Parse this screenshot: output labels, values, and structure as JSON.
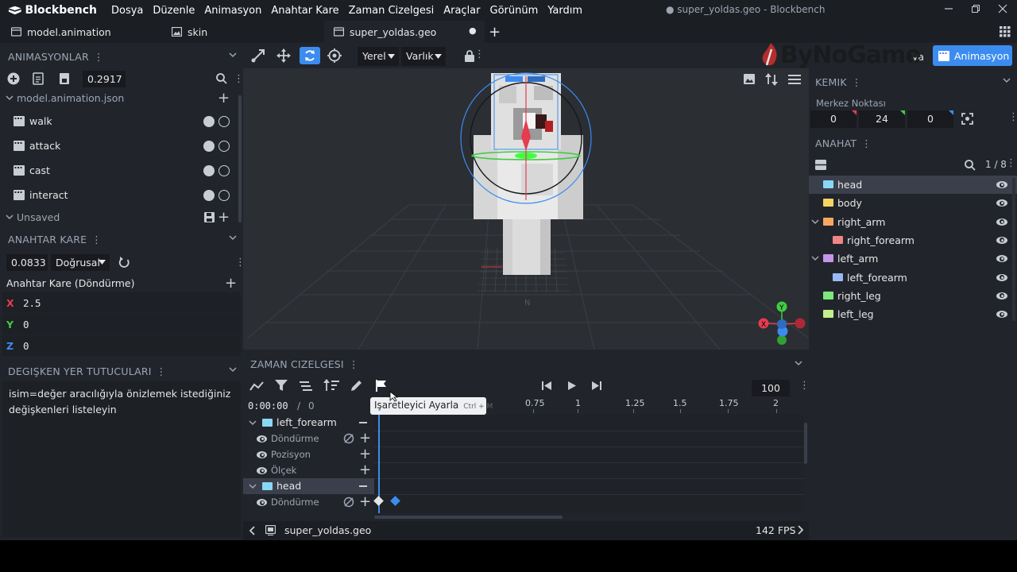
{
  "app": {
    "name": "Blockbench",
    "window_title": "● super_yoldas.geo - Blockbench"
  },
  "menus": [
    "Dosya",
    "Düzenle",
    "Animasyon",
    "Anahtar Kare",
    "Zaman Cizelgesi",
    "Araçlar",
    "Görünüm",
    "Yardım"
  ],
  "tabs": [
    {
      "label": "model.animation",
      "icon": "script-icon"
    },
    {
      "label": "skin",
      "icon": "image-icon"
    },
    {
      "label": "super_yoldas.geo",
      "icon": "model-icon",
      "active": true,
      "modified_marker": "●"
    }
  ],
  "animations_panel": {
    "title": "ANIMASYONLAR",
    "time_value": "0.2917",
    "file": "model.animation.json",
    "items": [
      "walk",
      "attack",
      "cast",
      "interact"
    ],
    "unsaved_label": "Unsaved"
  },
  "keyframe_panel": {
    "title": "ANAHTAR KARE",
    "time_value": "0.0833",
    "interpolation": "Doğrusal",
    "channel_title": "Anahtar Kare (Döndürme)",
    "axes": [
      {
        "axis": "X",
        "value": "2.5",
        "color": "#e53c50"
      },
      {
        "axis": "Y",
        "value": "0",
        "color": "#40cc40"
      },
      {
        "axis": "Z",
        "value": "0",
        "color": "#3c8cf0"
      }
    ]
  },
  "placeholders_panel": {
    "title": "DEGIŞKEN YER TUTUCULARI",
    "hint": "isim=değer aracılığıyla önizlemek istediğiniz değişkenleri listeleyin"
  },
  "viewport_toolbar": {
    "space_dropdown": "Yerel",
    "pivot_dropdown": "Varlık",
    "mode_label": "Animasyon",
    "other_mode_partial": "ya"
  },
  "watermark": "ByNoGame",
  "bone_panel": {
    "title": "KEMIK",
    "pivot_label": "Merkez Noktası",
    "pivot": [
      "0",
      "24",
      "0"
    ]
  },
  "outliner": {
    "title": "ANAHAT",
    "count": "1 / 8",
    "items": [
      {
        "name": "head",
        "color": "#8ad7f5",
        "level": 0,
        "selected": true
      },
      {
        "name": "body",
        "color": "#f3d564",
        "level": 0
      },
      {
        "name": "right_arm",
        "color": "#f5a960",
        "level": 0,
        "expanded": true
      },
      {
        "name": "right_forearm",
        "color": "#f08585",
        "level": 1
      },
      {
        "name": "left_arm",
        "color": "#c694e8",
        "level": 0,
        "expanded": true
      },
      {
        "name": "left_forearm",
        "color": "#9bb8f5",
        "level": 1
      },
      {
        "name": "right_leg",
        "color": "#7de87d",
        "level": 0
      },
      {
        "name": "left_leg",
        "color": "#c2f08a",
        "level": 0
      }
    ]
  },
  "timeline": {
    "title": "ZAMAN CIZELGESI",
    "time": "0:00:00",
    "time_sep": "/",
    "time_frame": "0",
    "fps_input": "100",
    "ruler": [
      "0.75",
      "1",
      "1.25",
      "1.5",
      "1.75",
      "2"
    ],
    "tooltip_label": "Işaretleyici Ayarla",
    "tooltip_shortcut": "Ctrl + M",
    "groups": [
      {
        "name": "left_forearm",
        "channels": [
          "Döndürme",
          "Pozisyon",
          "Ölçek"
        ]
      },
      {
        "name": "head",
        "channels": [
          "Döndürme"
        ]
      }
    ]
  },
  "status": {
    "file": "super_yoldas.geo",
    "fps": "142 FPS"
  }
}
